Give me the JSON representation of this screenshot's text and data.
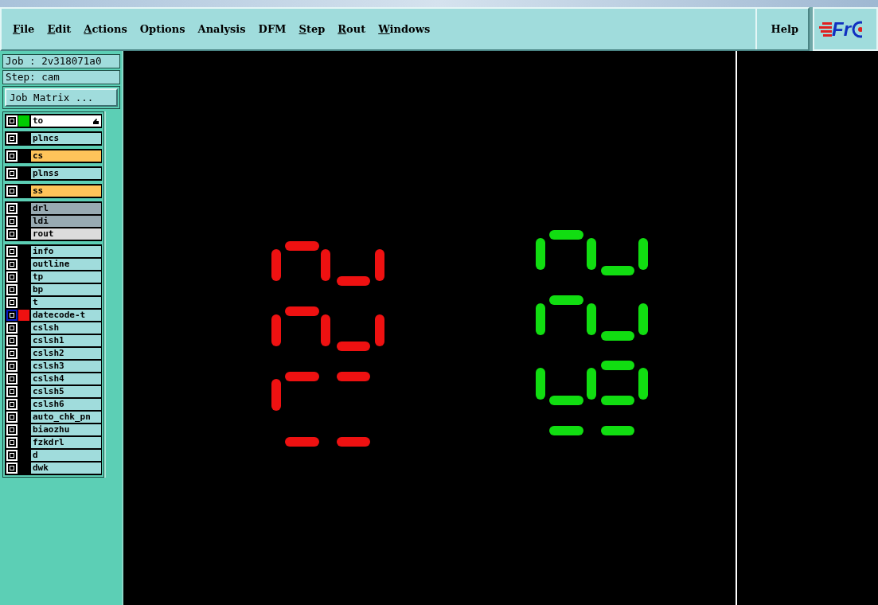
{
  "menu": [
    {
      "label": "File",
      "underlined": true
    },
    {
      "label": "Edit",
      "underlined": true
    },
    {
      "label": "Actions",
      "underlined": true
    },
    {
      "label": "Options",
      "underlined": false
    },
    {
      "label": "Analysis",
      "underlined": false
    },
    {
      "label": "DFM",
      "underlined": false
    },
    {
      "label": "Step",
      "underlined": true
    },
    {
      "label": "Rout",
      "underlined": true
    },
    {
      "label": "Windows",
      "underlined": true
    }
  ],
  "help": {
    "label": "Help"
  },
  "logo": "Fr",
  "job": "Job : 2v318071a0",
  "step": "Step: cam",
  "job_matrix_button": "Job Matrix ...",
  "layer_groups": [
    [
      {
        "name": "to",
        "kind": "work",
        "color": "#00cc00",
        "selected": false
      }
    ],
    [
      {
        "name": "plncs",
        "kind": "power",
        "selected": false
      }
    ],
    [
      {
        "name": "cs",
        "kind": "signal",
        "selected": false
      }
    ],
    [
      {
        "name": "plnss",
        "kind": "power",
        "selected": false
      }
    ],
    [
      {
        "name": "ss",
        "kind": "signal",
        "selected": false
      }
    ],
    [
      {
        "name": "drl",
        "kind": "drill",
        "selected": false
      },
      {
        "name": "ldi",
        "kind": "drill",
        "selected": false
      },
      {
        "name": "rout",
        "kind": "rout",
        "selected": false
      }
    ],
    [
      {
        "name": "info",
        "kind": "misc",
        "selected": false
      },
      {
        "name": "outline",
        "kind": "misc",
        "selected": false
      },
      {
        "name": "tp",
        "kind": "misc",
        "selected": false
      },
      {
        "name": "bp",
        "kind": "misc",
        "selected": false
      },
      {
        "name": "t",
        "kind": "misc",
        "selected": false
      },
      {
        "name": "datecode-t",
        "kind": "misc",
        "color": "#ee1111",
        "selected": true
      },
      {
        "name": "cslsh",
        "kind": "misc",
        "selected": false
      },
      {
        "name": "cslsh1",
        "kind": "misc",
        "selected": false
      },
      {
        "name": "cslsh2",
        "kind": "misc",
        "selected": false
      },
      {
        "name": "cslsh3",
        "kind": "misc",
        "selected": false
      },
      {
        "name": "cslsh4",
        "kind": "misc",
        "selected": false
      },
      {
        "name": "cslsh5",
        "kind": "misc",
        "selected": false
      },
      {
        "name": "cslsh6",
        "kind": "misc",
        "selected": false
      },
      {
        "name": "auto_chk_pn",
        "kind": "misc",
        "selected": false
      },
      {
        "name": "biaozhu",
        "kind": "misc",
        "selected": false
      },
      {
        "name": "fzkdrl",
        "kind": "misc",
        "selected": false
      },
      {
        "name": "d",
        "kind": "misc",
        "selected": false
      },
      {
        "name": "dwk",
        "kind": "misc",
        "selected": false
      }
    ]
  ]
}
